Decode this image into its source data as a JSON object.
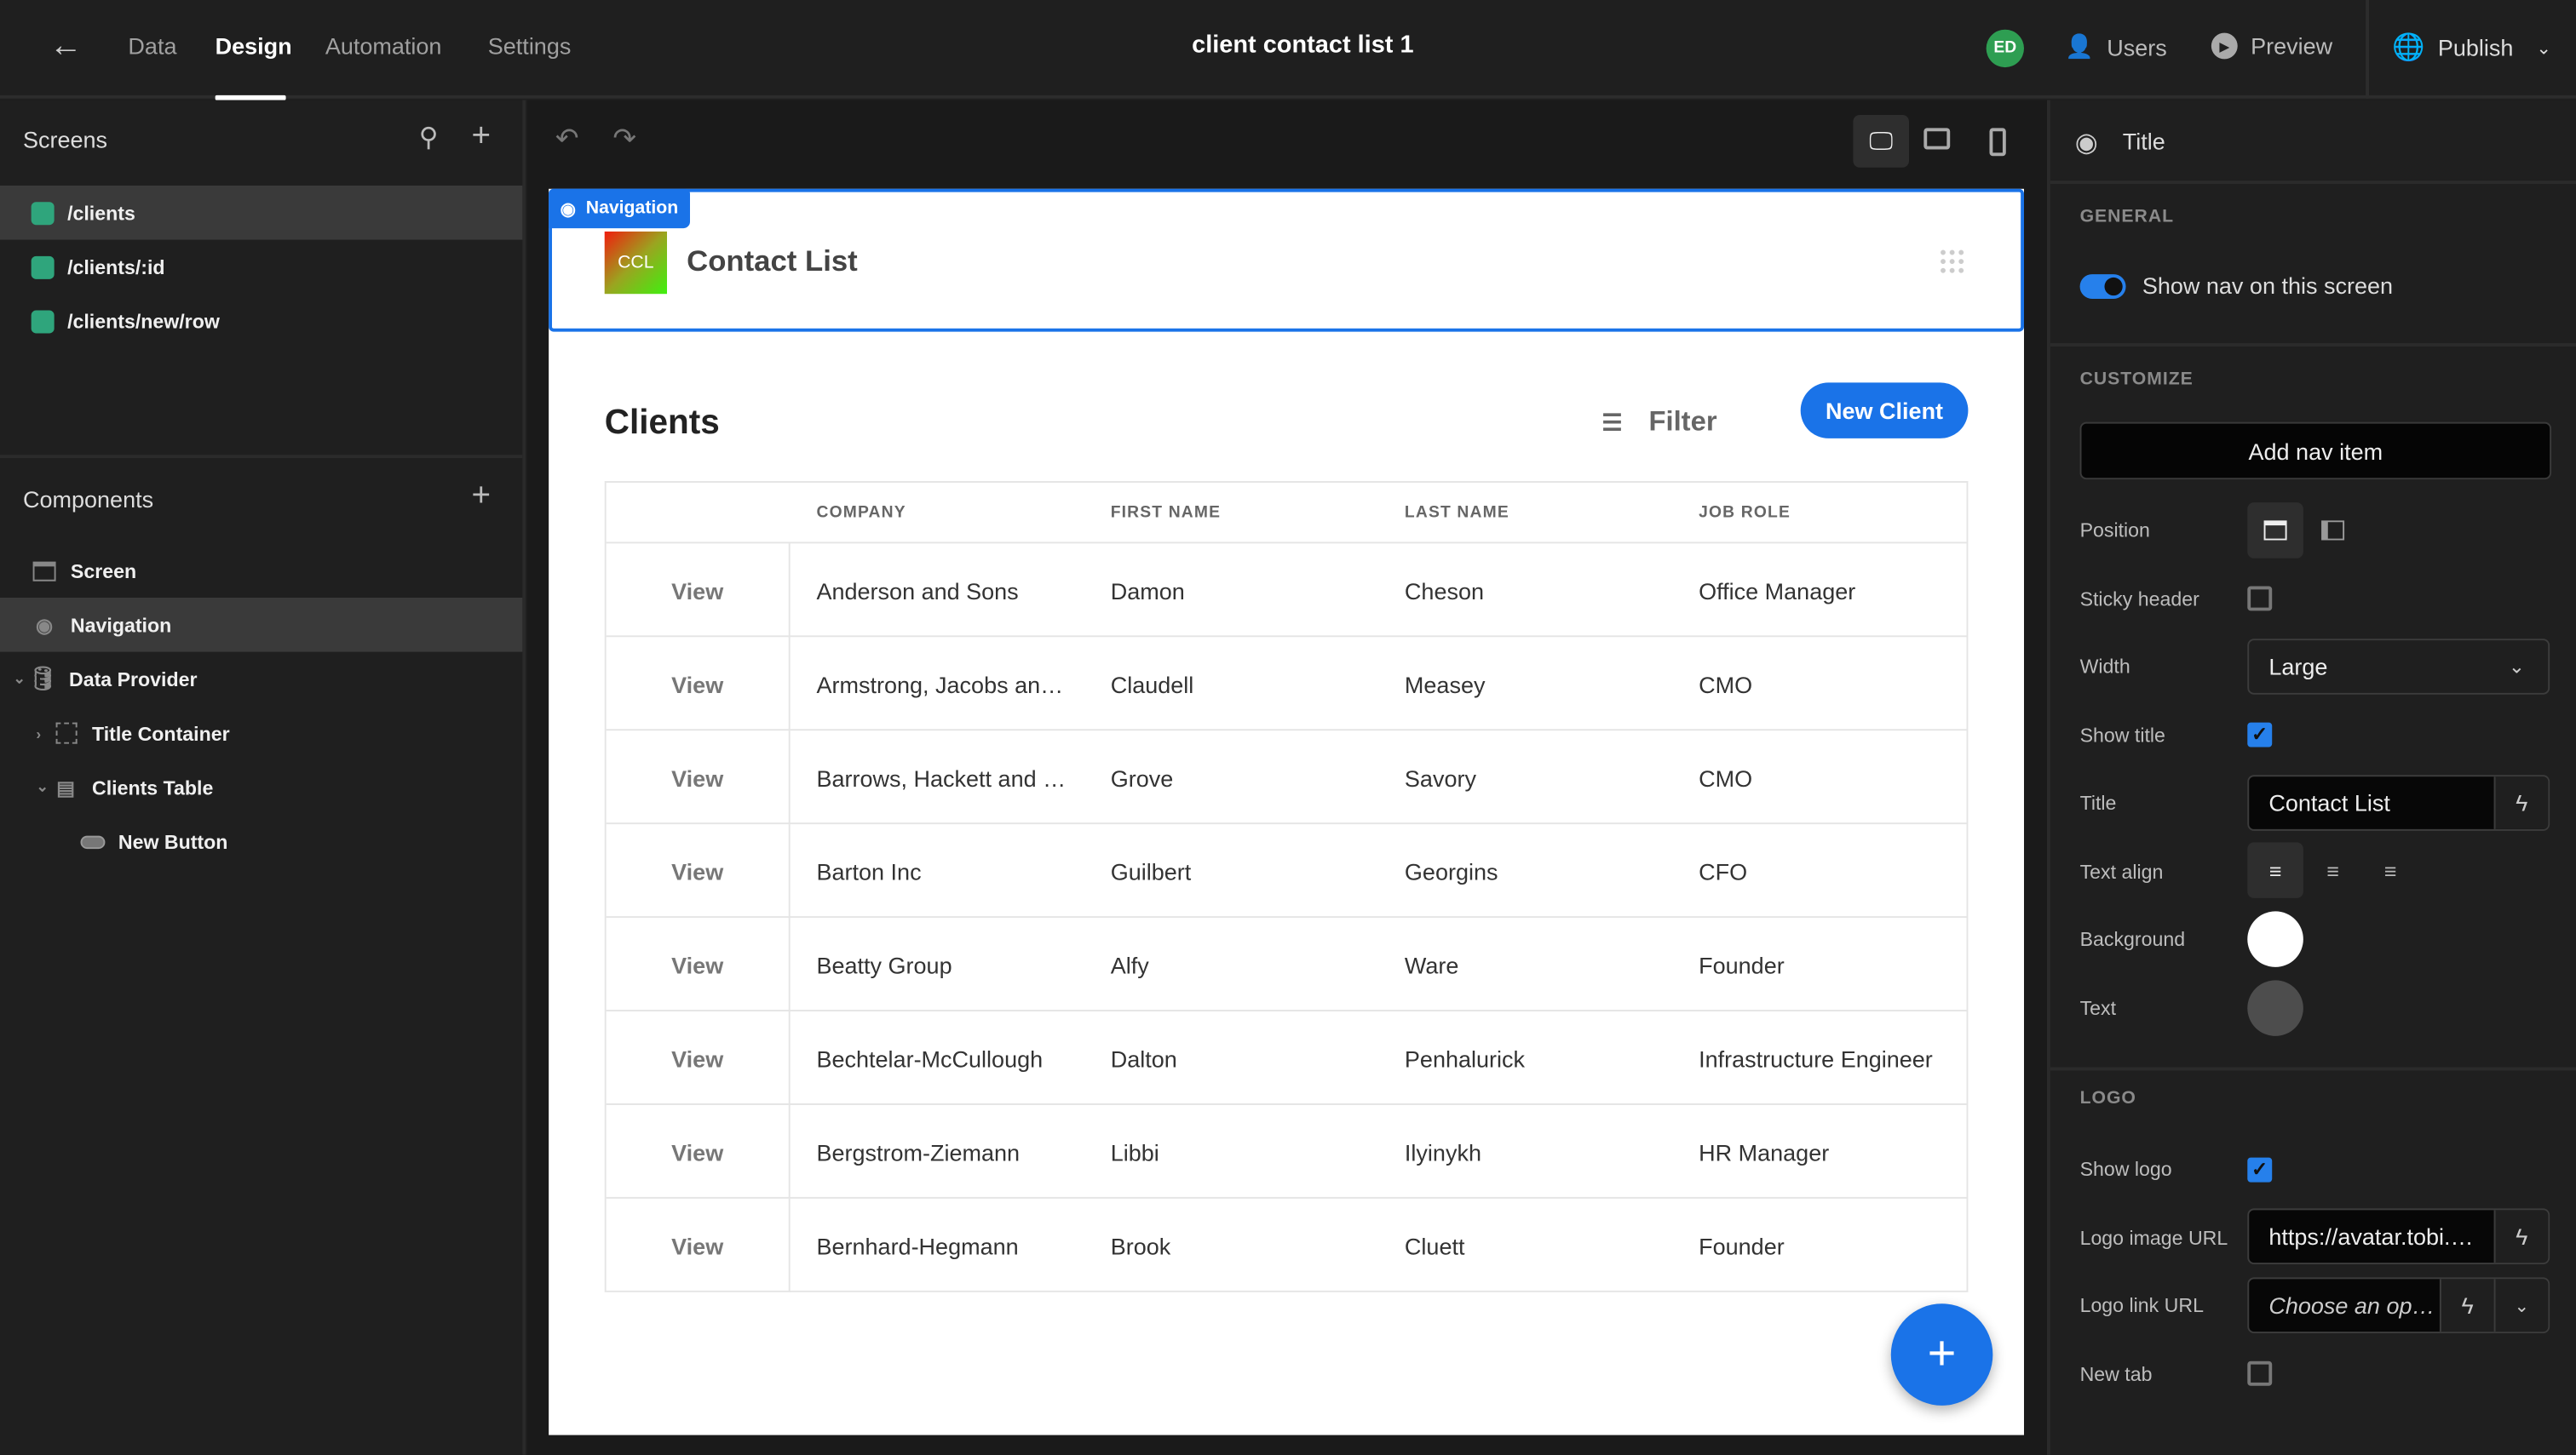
{
  "topbar": {
    "back": "back-arrow",
    "tabs": [
      {
        "label": "Data"
      },
      {
        "label": "Design"
      },
      {
        "label": "Automation"
      },
      {
        "label": "Settings"
      }
    ],
    "active_tab": "Design",
    "app_title": "client contact list 1",
    "avatar": "ED",
    "users": "Users",
    "preview": "Preview",
    "publish": "Publish"
  },
  "left": {
    "screens_title": "Screens",
    "screens": [
      {
        "label": "/clients"
      },
      {
        "label": "/clients/:id"
      },
      {
        "label": "/clients/new/row"
      }
    ],
    "components_title": "Components",
    "components": [
      {
        "label": "Screen",
        "icon": "screen-icon"
      },
      {
        "label": "Navigation",
        "icon": "eye-icon"
      },
      {
        "label": "Data Provider",
        "icon": "database-icon"
      },
      {
        "label": "Title Container",
        "icon": "container-icon"
      },
      {
        "label": "Clients Table",
        "icon": "table-icon"
      },
      {
        "label": "New Button",
        "icon": "button-icon"
      }
    ]
  },
  "canvas": {
    "nav_tag": "Navigation",
    "logo_text": "CCL",
    "nav_title": "Contact List",
    "page_title": "Clients",
    "filter": "Filter",
    "new_button": "New Client",
    "columns": [
      "COMPANY",
      "FIRST NAME",
      "LAST NAME",
      "JOB ROLE"
    ],
    "rows": [
      {
        "view": "View",
        "company": "Anderson and Sons",
        "first": "Damon",
        "last": "Cheson",
        "role": "Office Manager"
      },
      {
        "view": "View",
        "company": "Armstrong, Jacobs an…",
        "first": "Claudell",
        "last": "Measey",
        "role": "CMO"
      },
      {
        "view": "View",
        "company": "Barrows, Hackett and …",
        "first": "Grove",
        "last": "Savory",
        "role": "CMO"
      },
      {
        "view": "View",
        "company": "Barton Inc",
        "first": "Guilbert",
        "last": "Georgins",
        "role": "CFO"
      },
      {
        "view": "View",
        "company": "Beatty Group",
        "first": "Alfy",
        "last": "Ware",
        "role": "Founder"
      },
      {
        "view": "View",
        "company": "Bechtelar-McCullough",
        "first": "Dalton",
        "last": "Penhalurick",
        "role": "Infrastructure Engineer"
      },
      {
        "view": "View",
        "company": "Bergstrom-Ziemann",
        "first": "Libbi",
        "last": "Ilyinykh",
        "role": "HR Manager"
      },
      {
        "view": "View",
        "company": "Bernhard-Hegmann",
        "first": "Brook",
        "last": "Cluett",
        "role": "Founder"
      }
    ]
  },
  "right": {
    "title": "Title",
    "general": "GENERAL",
    "show_nav": "Show nav on this screen",
    "show_nav_on": true,
    "customize": "CUSTOMIZE",
    "add_nav_item": "Add nav item",
    "position": "Position",
    "sticky": "Sticky header",
    "sticky_on": false,
    "width": "Width",
    "width_value": "Large",
    "show_title": "Show title",
    "show_title_on": true,
    "title_value": "Contact List",
    "text_align": "Text align",
    "text_align_value": "left",
    "background": "Background",
    "background_color": "#ffffff",
    "text": "Text",
    "text_color": "#4d4d4d",
    "logo": "LOGO",
    "show_logo": "Show logo",
    "show_logo_on": true,
    "logo_image_url": "Logo image URL",
    "logo_image_value": "https://avatar.tobi.…",
    "logo_link_url": "Logo link URL",
    "logo_link_placeholder": "Choose an op…",
    "new_tab": "New tab",
    "new_tab_on": false
  },
  "colors": {
    "accent": "#1a73e8",
    "screen_dot": "#2fa57c",
    "avatar": "#2e9e52"
  }
}
